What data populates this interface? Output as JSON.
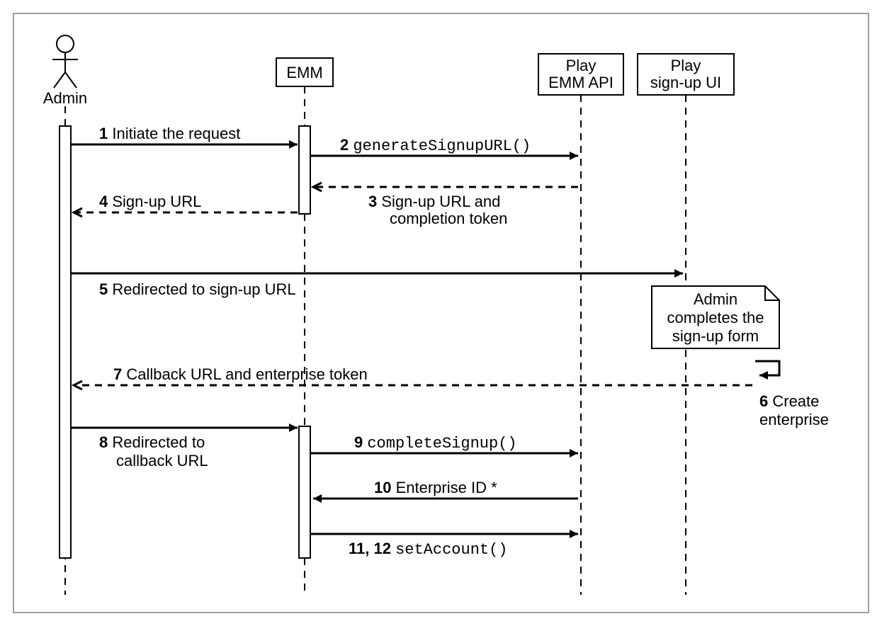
{
  "chart_data": {
    "type": "sequence-diagram",
    "participants": [
      {
        "id": "admin",
        "label": "Admin",
        "kind": "actor"
      },
      {
        "id": "emm",
        "label": "EMM",
        "kind": "object"
      },
      {
        "id": "playapi",
        "label": "Play\nEMM API",
        "kind": "object"
      },
      {
        "id": "playui",
        "label": "Play\nsign-up UI",
        "kind": "object"
      }
    ],
    "messages": [
      {
        "n": "1",
        "from": "admin",
        "to": "emm",
        "text": "Initiate the request",
        "style": "sync"
      },
      {
        "n": "2",
        "from": "emm",
        "to": "playapi",
        "text": "generateSignupURL()",
        "mono": true,
        "style": "sync"
      },
      {
        "n": "3",
        "from": "playapi",
        "to": "emm",
        "text": "Sign-up URL and\ncompletion token",
        "style": "return"
      },
      {
        "n": "4",
        "from": "emm",
        "to": "admin",
        "text": "Sign-up URL",
        "style": "return"
      },
      {
        "n": "5",
        "from": "admin",
        "to": "playui",
        "text": "Redirected to sign-up URL",
        "style": "sync"
      },
      {
        "note": "Admin\ncompletes the\nsign-up form",
        "at": "playui"
      },
      {
        "n": "6",
        "from": "playui",
        "to": "playui",
        "text": "Create\nenterprise",
        "style": "self"
      },
      {
        "n": "7",
        "from": "playui",
        "to": "admin",
        "text": "Callback URL and enterprise token",
        "style": "return"
      },
      {
        "n": "8",
        "from": "admin",
        "to": "emm",
        "text": "Redirected to\ncallback URL",
        "style": "sync"
      },
      {
        "n": "9",
        "from": "emm",
        "to": "playapi",
        "text": "completeSignup()",
        "mono": true,
        "style": "sync"
      },
      {
        "n": "10",
        "from": "playapi",
        "to": "emm",
        "text": "Enterprise ID *",
        "style": "sync"
      },
      {
        "n": "11, 12",
        "from": "emm",
        "to": "playapi",
        "text": "setAccount()",
        "mono": true,
        "style": "sync"
      }
    ]
  },
  "labels": {
    "admin": "Admin",
    "emm": "EMM",
    "playapi1": "Play",
    "playapi2": "EMM API",
    "playui1": "Play",
    "playui2": "sign-up UI",
    "m1n": "1",
    "m1t": " Initiate the request",
    "m2n": "2 ",
    "m2t": "generateSignupURL()",
    "m3n": "3",
    "m3t1": " Sign-up URL and",
    "m3t2": "completion token",
    "m4n": "4",
    "m4t": " Sign-up URL",
    "m5n": "5",
    "m5t": " Redirected to sign-up URL",
    "note1": "Admin",
    "note2": "completes the",
    "note3": "sign-up form",
    "m6n": "6",
    "m6t1": " Create",
    "m6t2": "enterprise",
    "m7n": "7",
    "m7t": " Callback URL and enterprise token",
    "m8n": "8",
    "m8t1": " Redirected to",
    "m8t2": "callback URL",
    "m9n": "9 ",
    "m9t": "completeSignup()",
    "m10n": "10",
    "m10t": " Enterprise ID *",
    "m11n": "11, 12 ",
    "m11t": "setAccount()"
  }
}
